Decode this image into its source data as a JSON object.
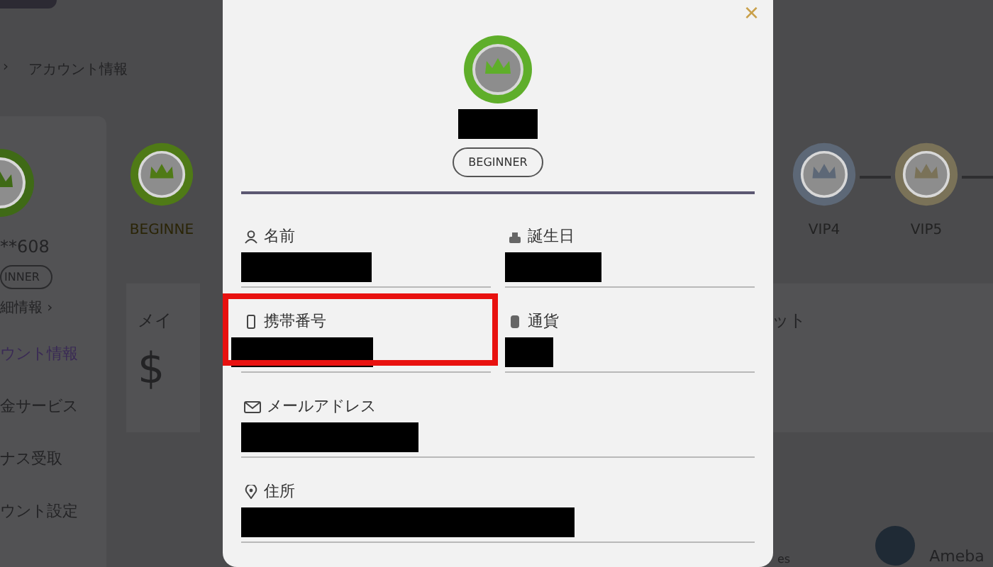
{
  "background": {
    "breadcrumb": {
      "separator": "›",
      "current": "アカウント情報"
    },
    "sidebar": {
      "username": "**608",
      "level_badge": "INNER",
      "details_link": "細情報 ›",
      "items": [
        {
          "label": "ウント情報",
          "selected": true
        },
        {
          "label": "金サービス",
          "selected": false
        },
        {
          "label": "ナス受取",
          "selected": false
        },
        {
          "label": "ウント設定",
          "selected": false
        }
      ]
    },
    "vip_levels": [
      {
        "label": "BEGINNE",
        "color": "#4f7a16"
      },
      {
        "label": "VIP4",
        "color": "#5d6877"
      },
      {
        "label": "VIP5",
        "color": "#7a7258"
      }
    ],
    "wallet_cards": [
      {
        "title": "メイ",
        "symbol": "$"
      },
      {
        "title": "ット"
      }
    ],
    "footer": {
      "text": "es",
      "user": "Ameba"
    }
  },
  "modal": {
    "close": "×",
    "username_redacted": true,
    "level": "BEGINNER",
    "fields": [
      {
        "label": "名前",
        "redacted": true,
        "highlighted": false
      },
      {
        "label": "誕生日",
        "redacted": true,
        "highlighted": false
      },
      {
        "label": "携帯番号",
        "redacted": true,
        "highlighted": true
      },
      {
        "label": "通貨",
        "redacted": true,
        "highlighted": false
      },
      {
        "label": "メールアドレス",
        "redacted": true,
        "highlighted": false
      },
      {
        "label": "住所",
        "redacted": true,
        "highlighted": false
      }
    ]
  }
}
